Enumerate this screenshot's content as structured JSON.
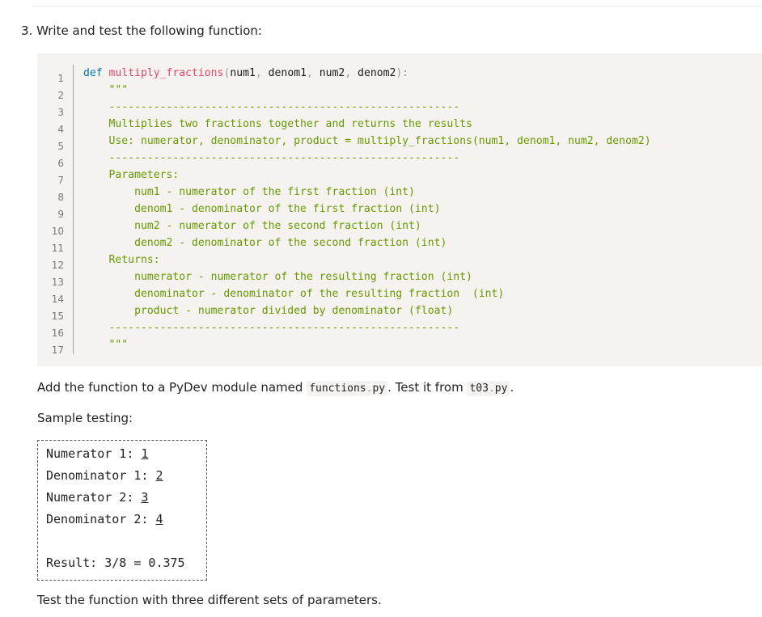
{
  "question": {
    "title": "3. Write and test the following function:"
  },
  "code": {
    "line_numbers": [
      "1",
      "2",
      "3",
      "4",
      "5",
      "6",
      "7",
      "8",
      "9",
      "10",
      "11",
      "12",
      "13",
      "14",
      "15",
      "16",
      "17"
    ],
    "def_kw": "def",
    "func_name": "multiply_fractions",
    "open_paren": "(",
    "param1": "num1",
    "comma1": ",",
    "param2": " denom1",
    "comma2": ",",
    "param3": " num2",
    "comma3": ",",
    "param4": " denom2",
    "close_sig": "):",
    "docstring": [
      "    \"\"\"",
      "    -------------------------------------------------------",
      "    Multiplies two fractions together and returns the results",
      "    Use: numerator, denominator, product = multiply_fractions(num1, denom1, num2, denom2)",
      "    -------------------------------------------------------",
      "    Parameters:",
      "        num1 - numerator of the first fraction (int)",
      "        denom1 - denominator of the first fraction (int)",
      "        num2 - numerator of the second fraction (int)",
      "        denom2 - denominator of the second fraction (int)",
      "    Returns:",
      "        numerator - numerator of the resulting fraction (int)",
      "        denominator - denominator of the resulting fraction  (int)",
      "        product - numerator divided by denominator (float)",
      "    -------------------------------------------------------",
      "    \"\"\""
    ]
  },
  "instructions": {
    "p1_a": "Add the function to a PyDev module named ",
    "p1_code1_a": "functions",
    "p1_code1_dot": ".",
    "p1_code1_b": "py",
    "p1_b": ". Test it from ",
    "p1_code2_a": "t03",
    "p1_code2_dot": ".",
    "p1_code2_b": "py",
    "p1_c": ".",
    "p2": "Sample testing:",
    "p3": "Test the function with three different sets of parameters."
  },
  "sample": {
    "num1_prompt": "Numerator 1: ",
    "num1_value": "1",
    "den1_prompt": "Denominator 1: ",
    "den1_value": "2",
    "num2_prompt": "Numerator 2: ",
    "num2_value": "3",
    "den2_prompt": "Denominator 2: ",
    "den2_value": "4",
    "result": "Result: 3/8 = 0.375"
  }
}
